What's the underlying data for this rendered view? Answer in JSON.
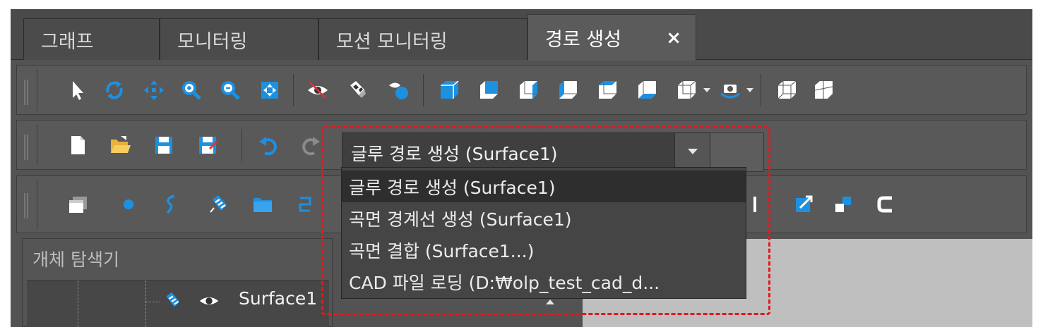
{
  "tabs": [
    {
      "label": "그래프"
    },
    {
      "label": "모니터링"
    },
    {
      "label": "모션 모니터링"
    },
    {
      "label": "경로 생성",
      "close": "×"
    }
  ],
  "toolbar_view": {
    "icons": [
      "select-arrow-icon",
      "rotate-icon",
      "pan-icon",
      "zoom-in-icon",
      "zoom-out-icon",
      "fit-all-icon",
      "hide-icon",
      "checker-icon",
      "show-sphere-icon",
      "view-iso-icon",
      "view-front-icon",
      "view-back-icon",
      "view-left-icon",
      "view-top-icon",
      "view-bottom-icon",
      "view-dropdown-icon",
      "camera-dropdown-icon",
      "wireframe-icon",
      "section-icon"
    ]
  },
  "toolbar_file": {
    "icons": [
      "new-file-icon",
      "open-folder-icon",
      "save-icon",
      "save-as-icon",
      "undo-icon",
      "redo-icon"
    ]
  },
  "combo": {
    "value": "글루 경로 생성 (Surface1)",
    "options": [
      {
        "label": "글루 경로 생성 (Surface1)",
        "selected": true
      },
      {
        "label": "곡면 경계선 생성 (Surface1)",
        "selected": false
      },
      {
        "label": "곡면 결합 (Surface1...)",
        "selected": false
      },
      {
        "label": "CAD 파일 로딩 (D:₩olp_test_cad_d...",
        "selected": false
      }
    ]
  },
  "toolbar_model": {
    "icons": [
      "layer-icon",
      "point-icon",
      "curve-icon",
      "surface-icon",
      "folder-icon",
      "path-icon",
      "export-icon",
      "split-icon",
      "trim-icon"
    ]
  },
  "explorer": {
    "title": "개체 탐색기",
    "items": [
      {
        "label": "Surface1"
      }
    ]
  },
  "colors": {
    "accent_blue": "#1e90e0",
    "highlight_red": "#e01a22",
    "panel": "#535353"
  }
}
